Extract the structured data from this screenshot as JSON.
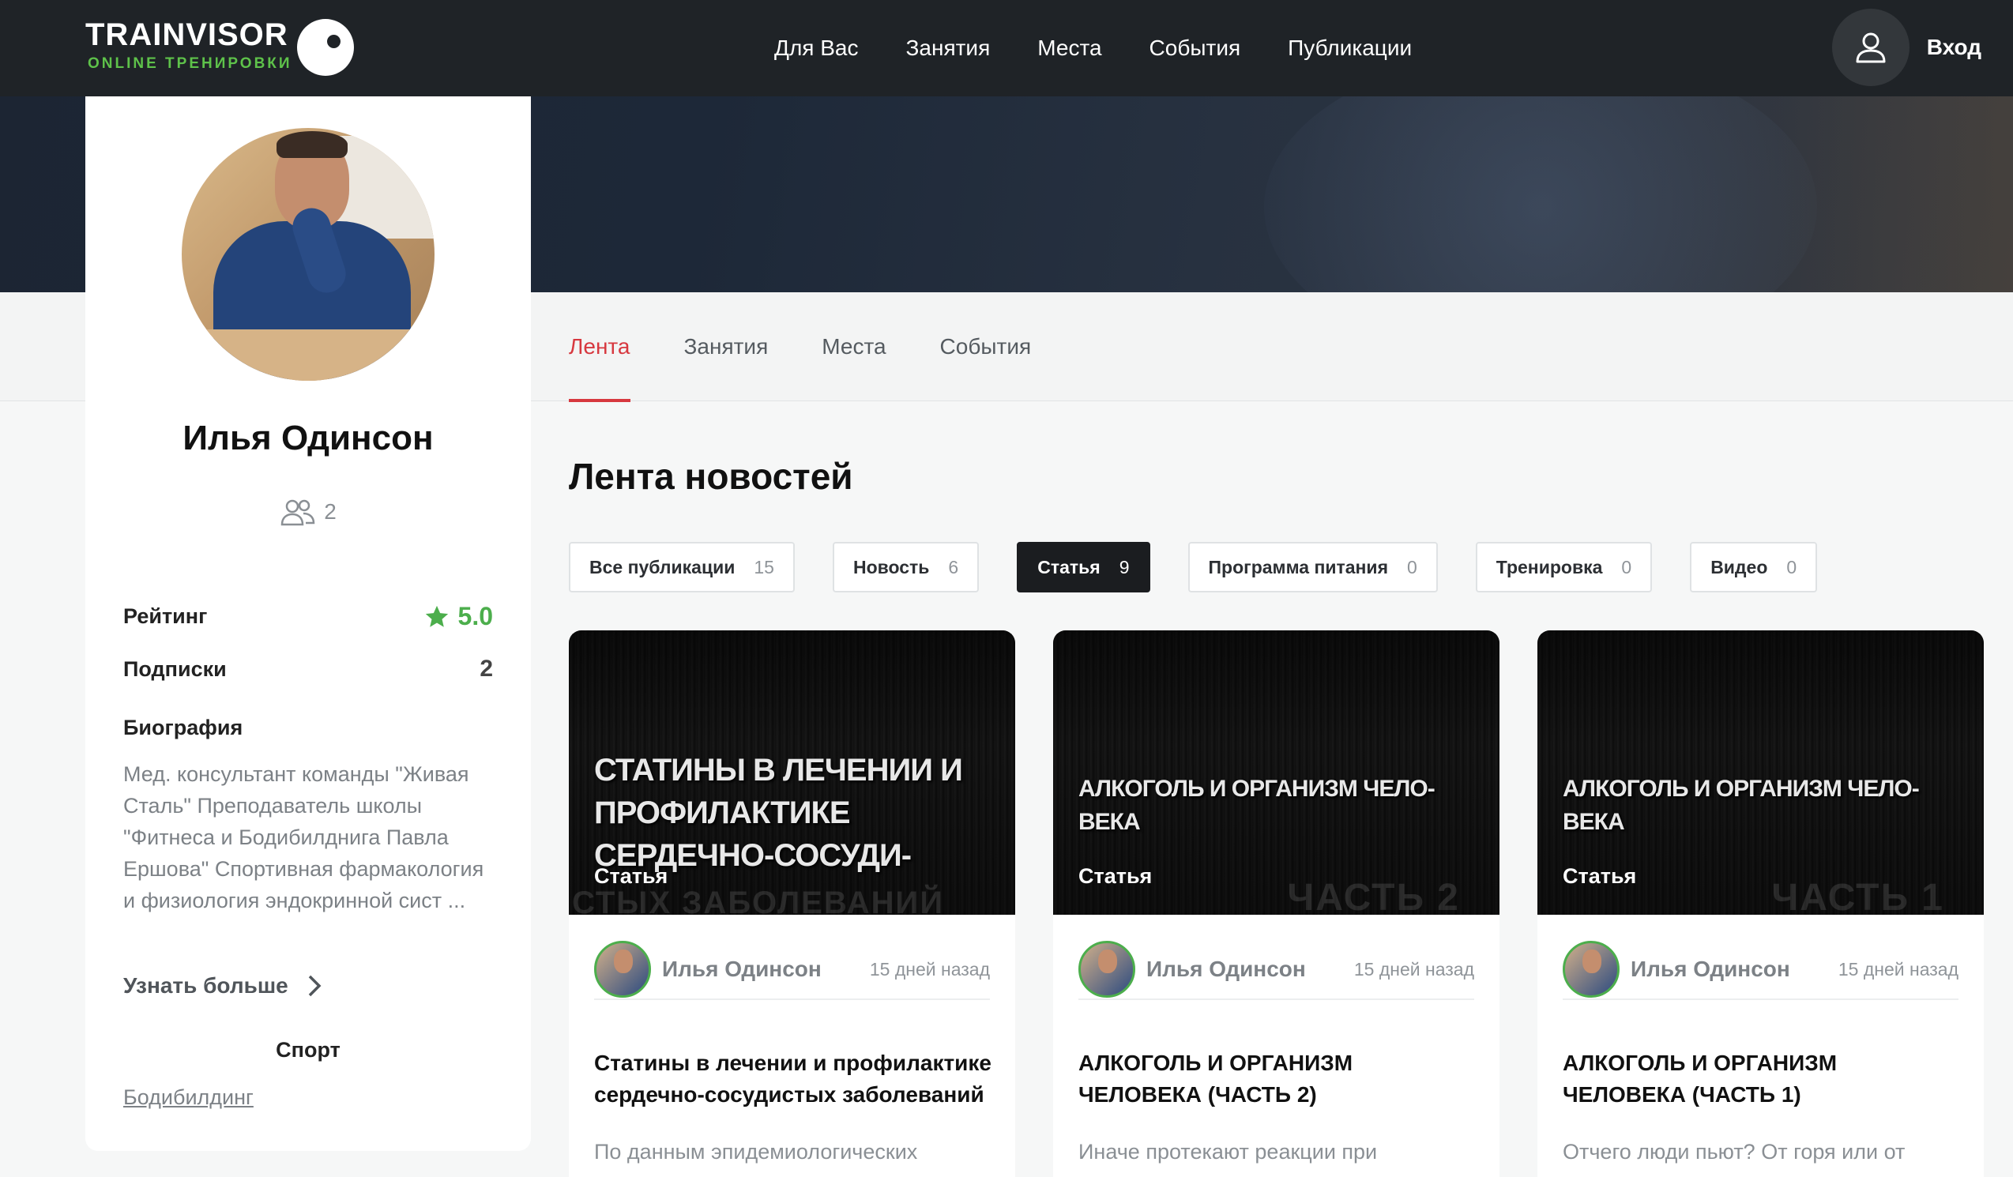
{
  "header": {
    "logo_text": "TRAINVISOR",
    "logo_sub": "ONLINE ТРЕНИРОВКИ",
    "nav": [
      "Для Вас",
      "Занятия",
      "Места",
      "События",
      "Публикации"
    ],
    "login_label": "Вход"
  },
  "profile": {
    "name": "Илья Одинсон",
    "followers_count": "2",
    "rating_label": "Рейтинг",
    "rating_value": "5.0",
    "subs_label": "Подписки",
    "subs_value": "2",
    "bio_title": "Биография",
    "bio_text": "Мед. консультант команды \"Живая Сталь\" Преподаватель школы \"Фитнеса и Бодибилднига Павла Ершова\" Спортивная фармакология и физиология эндокринной сист ...",
    "more_label": "Узнать больше",
    "sport_title": "Спорт",
    "sport_link": "Бодибилдинг"
  },
  "tabs": [
    {
      "label": "Лента",
      "active": true
    },
    {
      "label": "Занятия",
      "active": false
    },
    {
      "label": "Места",
      "active": false
    },
    {
      "label": "События",
      "active": false
    }
  ],
  "feed": {
    "title": "Лента новостей",
    "filters": [
      {
        "label": "Все публикации",
        "count": "15",
        "active": false
      },
      {
        "label": "Новость",
        "count": "6",
        "active": false
      },
      {
        "label": "Статья",
        "count": "9",
        "active": true
      },
      {
        "label": "Программа питания",
        "count": "0",
        "active": false
      },
      {
        "label": "Тренировка",
        "count": "0",
        "active": false
      },
      {
        "label": "Видео",
        "count": "0",
        "active": false
      }
    ],
    "cards": [
      {
        "image_title": "СТАТИНЫ В ЛЕЧЕНИИ И ПРОФИЛАКТИКЕ СЕРДЕЧНО-СОСУДИ-",
        "image_ghost": "СТЫХ ЗАБОЛЕВАНИЙ",
        "category": "Статья",
        "author": "Илья Одинсон",
        "time": "15 дней назад",
        "title": "Статины в лечении и профилактике сердечно-сосудистых заболеваний",
        "excerpt": "По данным эпидемиологических"
      },
      {
        "image_title": "АЛКОГОЛЬ И ОРГАНИЗМ ЧЕЛО-ВЕКА",
        "image_ghost": "ЧАСТЬ 2",
        "category": "Статья",
        "author": "Илья Одинсон",
        "time": "15 дней назад",
        "title": "АЛКОГОЛЬ И ОРГАНИЗМ ЧЕЛОВЕКА (ЧАСТЬ 2)",
        "excerpt": "Иначе протекают реакции при"
      },
      {
        "image_title": "АЛКОГОЛЬ И ОРГАНИЗМ ЧЕЛО-ВЕКА",
        "image_ghost": "ЧАСТЬ 1",
        "category": "Статья",
        "author": "Илья Одинсон",
        "time": "15 дней назад",
        "title": "АЛКОГОЛЬ И ОРГАНИЗМ ЧЕЛОВЕКА (ЧАСТЬ 1)",
        "excerpt": "Отчего люди пьют? От горя или от"
      }
    ]
  },
  "colors": {
    "header_bg": "#1f2327",
    "accent_red": "#d7383f",
    "accent_green": "#4cae4c"
  },
  "icons": {
    "logo": "eye-logo-icon",
    "login": "user-icon",
    "followers": "users-icon",
    "rating": "star-icon",
    "more": "chevron-right-icon"
  }
}
